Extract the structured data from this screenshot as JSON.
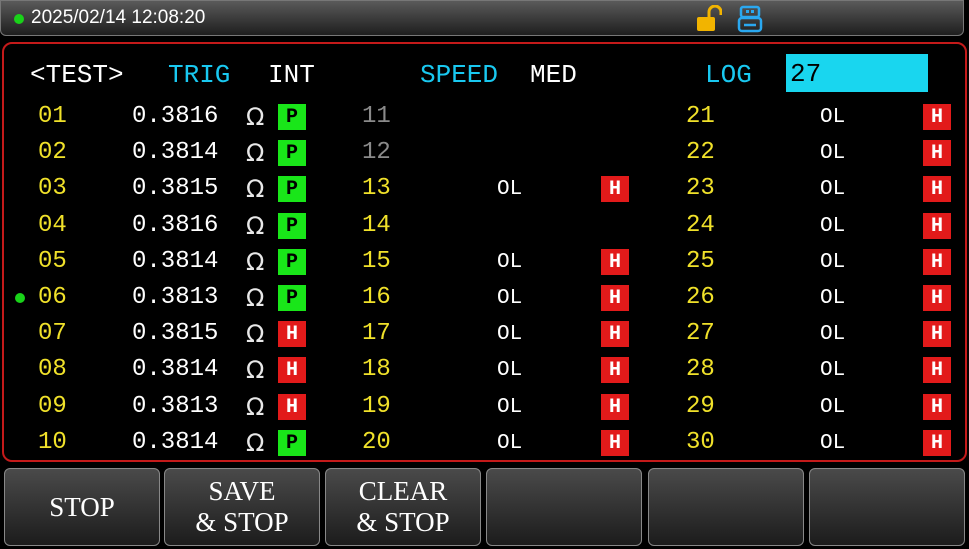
{
  "status_bar": {
    "datetime": "2025/02/14  12:08:20",
    "lock_icon": "unlocked-padlock-icon",
    "usb_icon": "usb-drive-icon"
  },
  "header": {
    "page": "<TEST>",
    "trig_label": "TRIG",
    "trig_value": "INT",
    "speed_label": "SPEED",
    "speed_value": "MED",
    "log_label": "LOG",
    "log_value": "27"
  },
  "columns": [
    {
      "rows": [
        {
          "ch": "01",
          "value": "0.3816",
          "unit": "Ω",
          "status": "P"
        },
        {
          "ch": "02",
          "value": "0.3814",
          "unit": "Ω",
          "status": "P"
        },
        {
          "ch": "03",
          "value": "0.3815",
          "unit": "Ω",
          "status": "P"
        },
        {
          "ch": "04",
          "value": "0.3816",
          "unit": "Ω",
          "status": "P"
        },
        {
          "ch": "05",
          "value": "0.3814",
          "unit": "Ω",
          "status": "P"
        },
        {
          "ch": "06",
          "value": "0.3813",
          "unit": "Ω",
          "status": "P",
          "current": true
        },
        {
          "ch": "07",
          "value": "0.3815",
          "unit": "Ω",
          "status": "H"
        },
        {
          "ch": "08",
          "value": "0.3814",
          "unit": "Ω",
          "status": "H"
        },
        {
          "ch": "09",
          "value": "0.3813",
          "unit": "Ω",
          "status": "H"
        },
        {
          "ch": "10",
          "value": "0.3814",
          "unit": "Ω",
          "status": "P"
        }
      ]
    },
    {
      "rows": [
        {
          "ch": "11",
          "value": "",
          "status": "",
          "dim": true
        },
        {
          "ch": "12",
          "value": "",
          "status": "",
          "dim": true
        },
        {
          "ch": "13",
          "value": "OL",
          "status": "H"
        },
        {
          "ch": "14",
          "value": "",
          "status": ""
        },
        {
          "ch": "15",
          "value": "OL",
          "status": "H"
        },
        {
          "ch": "16",
          "value": "OL",
          "status": "H"
        },
        {
          "ch": "17",
          "value": "OL",
          "status": "H"
        },
        {
          "ch": "18",
          "value": "OL",
          "status": "H"
        },
        {
          "ch": "19",
          "value": "OL",
          "status": "H"
        },
        {
          "ch": "20",
          "value": "OL",
          "status": "H"
        }
      ]
    },
    {
      "rows": [
        {
          "ch": "21",
          "value": "OL",
          "status": "H"
        },
        {
          "ch": "22",
          "value": "OL",
          "status": "H"
        },
        {
          "ch": "23",
          "value": "OL",
          "status": "H"
        },
        {
          "ch": "24",
          "value": "OL",
          "status": "H"
        },
        {
          "ch": "25",
          "value": "OL",
          "status": "H"
        },
        {
          "ch": "26",
          "value": "OL",
          "status": "H"
        },
        {
          "ch": "27",
          "value": "OL",
          "status": "H"
        },
        {
          "ch": "28",
          "value": "OL",
          "status": "H"
        },
        {
          "ch": "29",
          "value": "OL",
          "status": "H"
        },
        {
          "ch": "30",
          "value": "OL",
          "status": "H"
        }
      ]
    }
  ],
  "softkeys": [
    {
      "label": "STOP"
    },
    {
      "label": "SAVE\n& STOP"
    },
    {
      "label": "CLEAR\n& STOP"
    },
    {
      "label": ""
    },
    {
      "label": ""
    },
    {
      "label": ""
    }
  ],
  "colors": {
    "pass": "#19e619",
    "high": "#e21a1a",
    "channel": "#f0e12a",
    "accent": "#19c8f0",
    "frame": "#c41a1a"
  }
}
